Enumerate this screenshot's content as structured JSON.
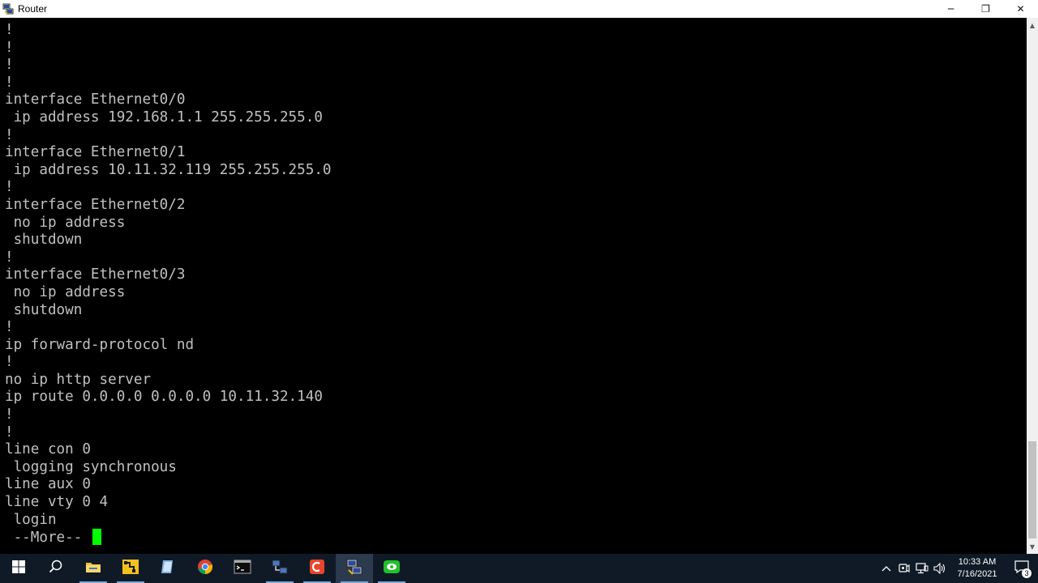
{
  "window": {
    "title": "Router",
    "minimize_glyph": "─",
    "restore_glyph": "❐",
    "close_glyph": "✕"
  },
  "terminal": {
    "lines": [
      "!",
      "!",
      "!",
      "!",
      "interface Ethernet0/0",
      " ip address 192.168.1.1 255.255.255.0",
      "!",
      "interface Ethernet0/1",
      " ip address 10.11.32.119 255.255.255.0",
      "!",
      "interface Ethernet0/2",
      " no ip address",
      " shutdown",
      "!",
      "interface Ethernet0/3",
      " no ip address",
      " shutdown",
      "!",
      "ip forward-protocol nd",
      "!",
      "no ip http server",
      "ip route 0.0.0.0 0.0.0.0 10.11.32.140",
      "!",
      "!",
      "line con 0",
      " logging synchronous",
      "line aux 0",
      "line vty 0 4",
      " login"
    ],
    "more_prompt": " --More-- ",
    "text_color": "#c0c0c0",
    "cursor_color": "#00ff00"
  },
  "taskbar": {
    "apps": [
      {
        "name": "start",
        "icon": "windows-logo-icon"
      },
      {
        "name": "search",
        "icon": "search-icon"
      },
      {
        "name": "file-explorer",
        "icon": "folder-icon"
      },
      {
        "name": "app-yellow",
        "icon": "network-tool-icon"
      },
      {
        "name": "app-blue",
        "icon": "paper-icon"
      },
      {
        "name": "chrome",
        "icon": "chrome-icon"
      },
      {
        "name": "terminal",
        "icon": "terminal-icon"
      },
      {
        "name": "putty-like",
        "icon": "network-computers-icon"
      },
      {
        "name": "app-red",
        "icon": "red-app-icon"
      },
      {
        "name": "router-session",
        "icon": "putty-icon"
      },
      {
        "name": "app-green",
        "icon": "green-app-icon"
      }
    ],
    "clock_time": "10:33 AM",
    "clock_date": "7/16/2021",
    "notification_count": "3"
  }
}
